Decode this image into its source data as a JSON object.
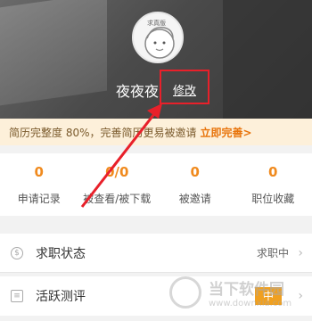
{
  "profile": {
    "avatar_tag": "求真版",
    "username": "夜夜夜",
    "edit_label": "修改"
  },
  "banner": {
    "text": "简历完整度 80%，完善简历更易被邀请",
    "action": "立即完善>"
  },
  "stats": [
    {
      "value": "0",
      "label": "申请记录"
    },
    {
      "value": "0/0",
      "label": "被查看/被下载"
    },
    {
      "value": "0",
      "label": "被邀请"
    },
    {
      "value": "0",
      "label": "职位收藏"
    }
  ],
  "menu": {
    "job_status": {
      "label": "求职状态",
      "value": "求职中"
    },
    "activity": {
      "label": "活跃测评",
      "value": "中"
    }
  },
  "watermark": {
    "title": "当下软件园",
    "subtitle": "www.downxia.com"
  },
  "colors": {
    "accent": "#f08a1e",
    "annotation": "#e8202a",
    "banner_bg": "#fdf0da"
  }
}
